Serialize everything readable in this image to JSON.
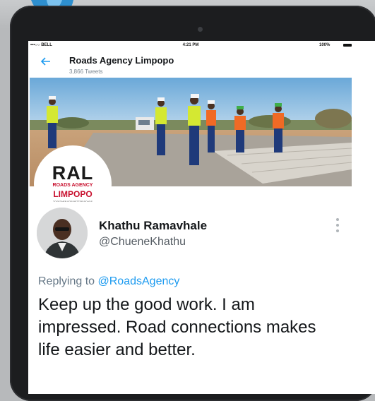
{
  "status_bar": {
    "carrier": "•••○○ BELL",
    "time": "4:21 PM",
    "battery": "100%"
  },
  "header": {
    "profile_name": "Roads Agency Limpopo",
    "tweet_count": "3,866 Tweets",
    "back_icon": "arrow-left-icon"
  },
  "logo": {
    "abbreviation": "RAL",
    "agency": "ROADS AGENCY",
    "region": "LIMPOPO",
    "tagline": "TOGETHER FOR BETTER ROADS"
  },
  "tweet": {
    "author_name": "Khathu Ramavhale",
    "author_handle": "@ChueneKhathu",
    "replying_prefix": "Replying to ",
    "replying_to": "@RoadsAgency",
    "text": "Keep up the good work. I am impressed. Road connections makes life easier and better.",
    "more_icon": "more-vertical-icon"
  },
  "colors": {
    "accent": "#1d9bf0",
    "brand_red": "#c8102e",
    "tablet_frame": "#1c1d1f"
  }
}
